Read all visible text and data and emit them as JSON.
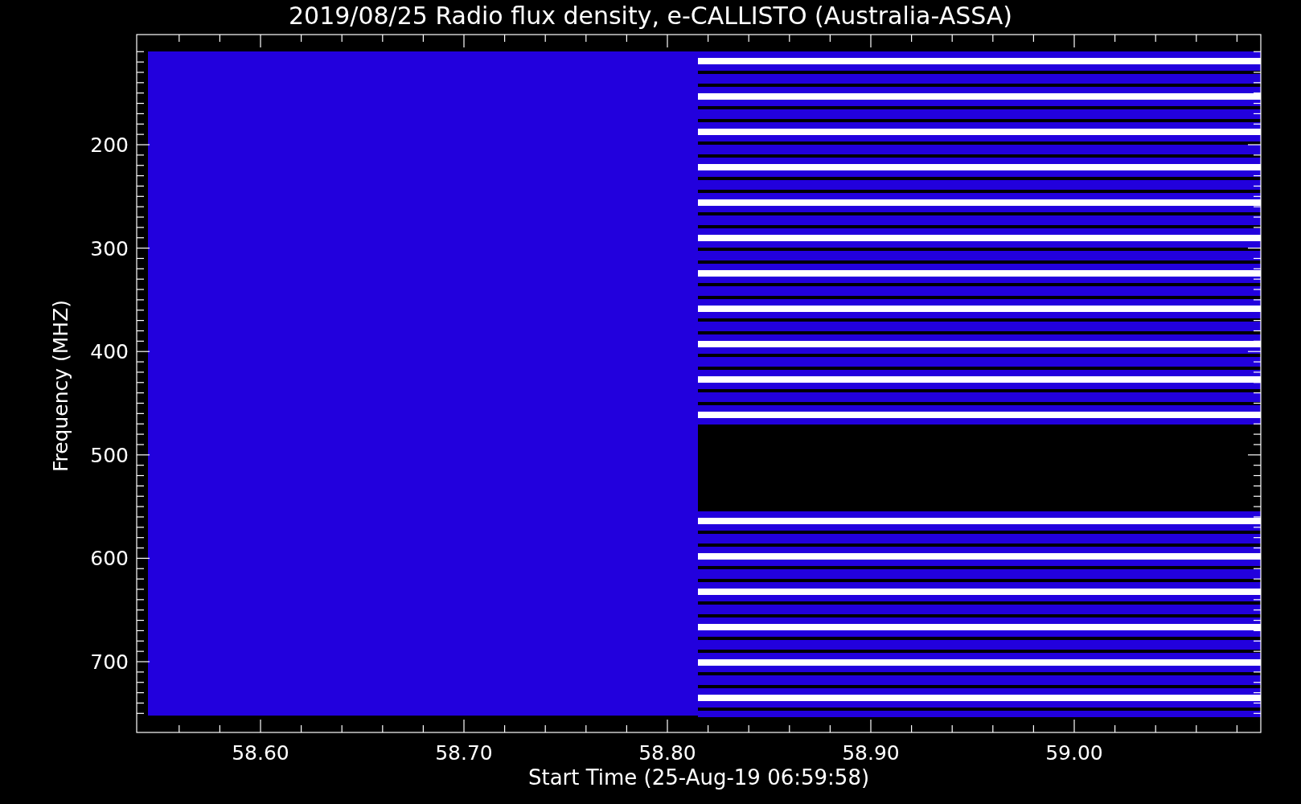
{
  "title": "2019/08/25  Radio flux density, e-CALLISTO (Australia-ASSA)",
  "ylabel": "Frequency (MHZ)",
  "xlabel": "Start Time (25-Aug-19 06:59:58)",
  "yticks": [
    "200",
    "300",
    "400",
    "500",
    "600",
    "700"
  ],
  "xticks": [
    "58.60",
    "58.70",
    "58.80",
    "58.90",
    "59.00"
  ]
}
